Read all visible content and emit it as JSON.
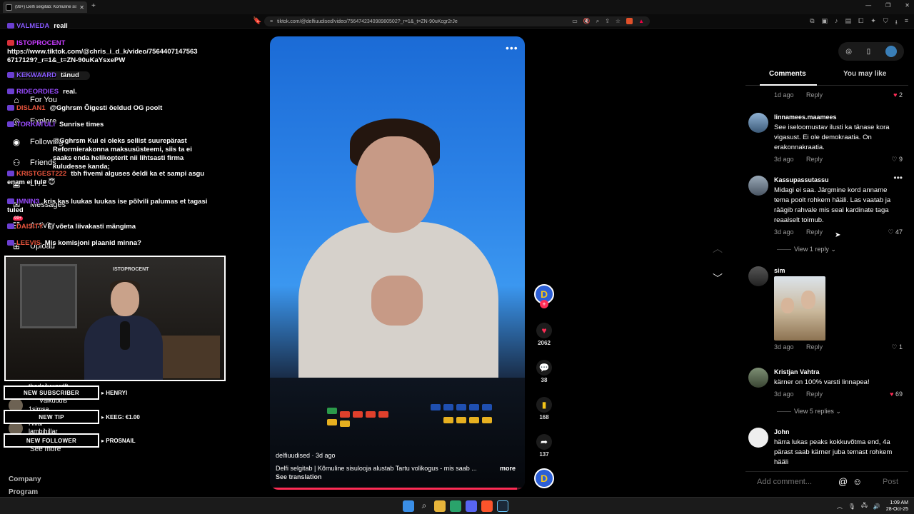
{
  "browser": {
    "tab_title": "(99+) Delfi selgitab: Kõmuline sis",
    "url": "tiktok.com/@delfiuudised/video/7564742340989805...?_r=1&_t=ZN-90uKcgr2rJe",
    "url_full": "tiktok.com/@delfiuudised/video/756474234098980502?_r=1&_t=ZN-90uKcgr2rJe"
  },
  "tiktok_nav": {
    "search_label": "Search",
    "items": [
      {
        "label": "For You",
        "icon": "home-icon"
      },
      {
        "label": "Explore",
        "icon": "compass-icon"
      },
      {
        "label": "Following",
        "icon": "following-icon"
      },
      {
        "label": "Friends",
        "icon": "friends-icon"
      },
      {
        "label": "LIVE",
        "icon": "live-icon"
      },
      {
        "label": "Messages",
        "icon": "message-icon"
      },
      {
        "label": "Activity",
        "icon": "activity-icon"
      },
      {
        "label": "Upload",
        "icon": "upload-icon"
      }
    ],
    "messages_badge": "99+",
    "following_accounts": [
      "thedailywordft",
      "Välkuudis",
      "1simsa",
      "Hillar",
      "lambihillar"
    ],
    "see_more": "See more",
    "footer": [
      "Company",
      "Program"
    ]
  },
  "chat": [
    {
      "name": "VALMEDA",
      "color": "#8a5cff",
      "msg": "reall"
    },
    {
      "name": "ISTOPROCENT",
      "color": "#c83cff",
      "msg": "https://www.tiktok.com/@chris_i_d_k/video/7564407147563 6717129?_r=1&_t=ZN-90uKaYsxePW"
    },
    {
      "name": "KEKWAARD",
      "color": "#8a5cff",
      "msg": "tänud"
    },
    {
      "name": "RIDEORDIES",
      "color": "#9a4cff",
      "msg": "real."
    },
    {
      "name": "DISLAN1",
      "color": "#e5533c",
      "msg": "@Gghrsm Õigesti öeldud OG poolt"
    },
    {
      "name": "TORKATULI",
      "color": "#9a4cff",
      "msg": "Sunrise times"
    },
    {
      "name": "",
      "color": "#9a4cff",
      "msg": "@Gghrsm Kui ei oleks sellist suurepärast Reformierakonna maksusüsteemi, siis ta ei saaks enda helikopterit nii lihtsasti firma kuludesse kanda;"
    },
    {
      "name": "KRISTGEST222",
      "color": "#e5533c",
      "msg": "tbh fivemi alguses öeldi ka et sampi asgu enam ei tule 😇"
    },
    {
      "name": "IMNIN3",
      "color": "#9a4cff",
      "msg": "kris kas luukas luukas ise põlvili palumas et tagasi tuled"
    },
    {
      "name": "DAISITY",
      "color": "#e5533c",
      "msg": "Ei võeta liivakasti mängima"
    },
    {
      "name": "LEEVIS",
      "color": "#e5533c",
      "msg": "Mis komisjoni plaanid minna?"
    }
  ],
  "webcam": {
    "logo": "ISTOPROCENT"
  },
  "alerts": [
    {
      "label": "NEW SUBSCRIBER",
      "value": "HENRYI"
    },
    {
      "label": "NEW TIP",
      "value": "KEEG: €1.00"
    },
    {
      "label": "NEW FOLLOWER",
      "value": "PROSNAIL"
    }
  ],
  "video": {
    "author": "delfiuudised · 3d ago",
    "description": "Delfi selgitab | Kõmuline sisulooja alustab Tartu volikogus - mis saab ...",
    "more": "more",
    "see_translation": "See translation",
    "progress": 0.97
  },
  "actions": {
    "likes": "2062",
    "comments": "38",
    "saves": "168",
    "shares": "137"
  },
  "panel": {
    "tabs": [
      "Comments",
      "You may like"
    ],
    "active_tab": 0,
    "partial_top": {
      "ago": "1d ago",
      "reply": "Reply",
      "likes": "2"
    },
    "comments": [
      {
        "user": "linnamees.maamees",
        "text": "See iseloomustav ilusti ka tänase kora vigasust. Ei ole demokraatia. On erakonnakraatia.",
        "ago": "3d ago",
        "reply": "Reply",
        "likes": "9",
        "liked": false
      },
      {
        "user": "Kassupassutassu",
        "text": "Midagi ei saa. Järgmine kord anname tema poolt rohkem hääli. Las vaatab ja räägib rahvale mis seal kardinate taga reaalselt toimub.",
        "ago": "3d ago",
        "reply": "Reply",
        "likes": "47",
        "liked": false,
        "view_replies": "View 1 reply"
      },
      {
        "user": "sim",
        "text": "",
        "has_image": true,
        "ago": "3d ago",
        "reply": "Reply",
        "likes": "1",
        "liked": false
      },
      {
        "user": "Kristjan Vahtra",
        "text": "kärner on 100% varsti linnapea!",
        "ago": "3d ago",
        "reply": "Reply",
        "likes": "69",
        "liked": true,
        "view_replies": "View 5 replies"
      },
      {
        "user": "John",
        "text": "härra lukas peaks kokkuvõtma end, 4a pärast saab kärner juba temast rohkem hääli",
        "ago": "",
        "reply": "",
        "likes": "",
        "liked": false
      }
    ],
    "add_comment": "Add comment...",
    "post": "Post"
  },
  "taskbar": {
    "time": "1:09 AM",
    "date": "28-Oct-25"
  },
  "colors": {
    "accent": "#fe2c55",
    "video_bg": "#2d84e8"
  }
}
